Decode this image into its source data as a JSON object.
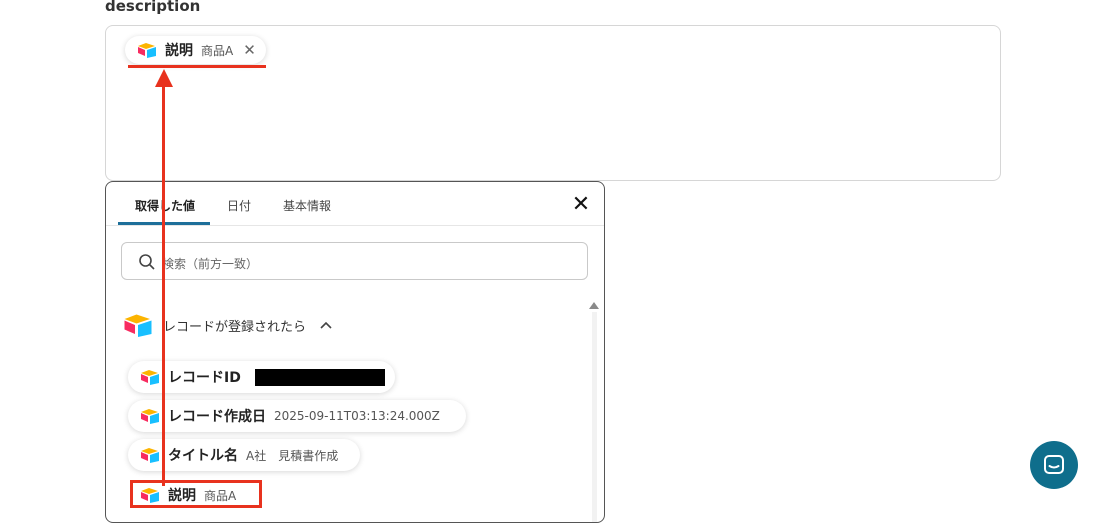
{
  "field": {
    "label": "description"
  },
  "description_chip": {
    "name": "説明",
    "value": "商品A",
    "remove_icon": "close-icon"
  },
  "panel": {
    "tabs": [
      {
        "label": "取得した値",
        "active": true
      },
      {
        "label": "日付",
        "active": false
      },
      {
        "label": "基本情報",
        "active": false
      }
    ],
    "close_icon": "close-icon",
    "search": {
      "placeholder": "検索（前方一致）",
      "icon": "search-icon"
    },
    "group": {
      "label": "レコードが登録されたら",
      "icon": "airtable-logo-icon",
      "expanded": true
    },
    "items": [
      {
        "name": "レコードID",
        "value": "",
        "redacted": true
      },
      {
        "name": "レコード作成日",
        "value": "2025-09-11T03:13:24.000Z"
      },
      {
        "name": "タイトル名",
        "value": "A社　見積書作成"
      },
      {
        "name": "説明",
        "value": "商品A"
      }
    ]
  },
  "annotation_color": "#e8321e",
  "accent_color": "#1d6f9a",
  "chat_button": {
    "icon": "chat-icon",
    "color": "#0f6e8c"
  }
}
